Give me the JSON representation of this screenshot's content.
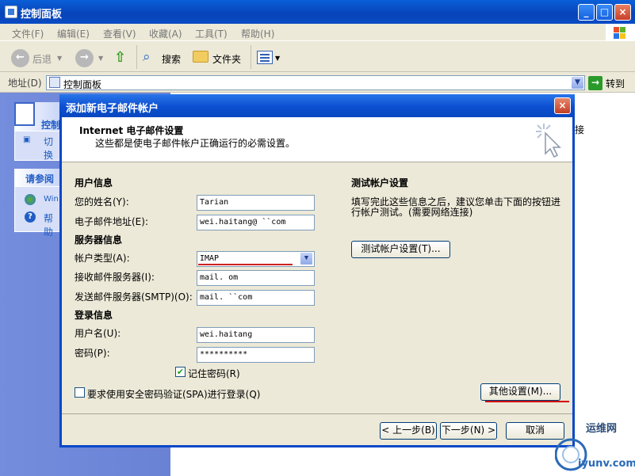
{
  "window": {
    "title": "控制面板",
    "controls": {
      "minimize": "_",
      "maximize": "□",
      "close": "×"
    }
  },
  "menubar": {
    "items": [
      "文件(F)",
      "编辑(E)",
      "查看(V)",
      "收藏(A)",
      "工具(T)",
      "帮助(H)"
    ]
  },
  "toolbar": {
    "back_label": "后退",
    "search_label": "搜索",
    "folders_label": "文件夹"
  },
  "address": {
    "label": "地址(D)",
    "value": "控制面板",
    "go_label": "转到"
  },
  "background": {
    "sidebar_head_1": "控制",
    "sidebar_item_1": "切换",
    "sidebar_head_2": "请参阅",
    "sidebar_item_2": "Win",
    "sidebar_item_3": "帮助",
    "content_fragment": "接"
  },
  "dialog": {
    "title": "添加新电子邮件帐户",
    "close": "×",
    "header_title": "Internet 电子邮件设置",
    "header_subtitle": "这些都是使电子邮件帐户正确运行的必需设置。",
    "user_info": {
      "heading": "用户信息",
      "name_label": "您的姓名(Y):",
      "name_value": "Tarian",
      "email_label": "电子邮件地址(E):",
      "email_value": "wei.haitang@    ``com"
    },
    "server_info": {
      "heading": "服务器信息",
      "account_type_label": "帐户类型(A):",
      "account_type_value": "IMAP",
      "incoming_label": "接收邮件服务器(I):",
      "incoming_value": "mail.      om",
      "outgoing_label": "发送邮件服务器(SMTP)(O):",
      "outgoing_value": "mail.     ``com"
    },
    "logon_info": {
      "heading": "登录信息",
      "username_label": "用户名(U):",
      "username_value": "wei.haitang",
      "password_label": "密码(P):",
      "password_value": "**********",
      "remember_label": "记住密码(R)",
      "remember_checked": true,
      "spa_label": "要求使用安全密码验证(SPA)进行登录(Q)",
      "spa_checked": false
    },
    "test": {
      "heading": "测试帐户设置",
      "description_line1": "填写完此这些信息之后，建议您单击下面的按钮进",
      "description_line2": "行帐户测试。(需要网络连接)",
      "button": "测试帐户设置(T)..."
    },
    "more_settings_button": "其他设置(M)...",
    "back_button": "< 上一步(B)",
    "next_button": "下一步(N) >",
    "cancel_button": "取消"
  },
  "watermark": {
    "text": "运维网",
    "url_text": "iyunv.com"
  },
  "colors": {
    "title_blue": "#0a4cc4",
    "annotation_red": "#d40000",
    "sidebar_blue": "#6a82d4"
  }
}
